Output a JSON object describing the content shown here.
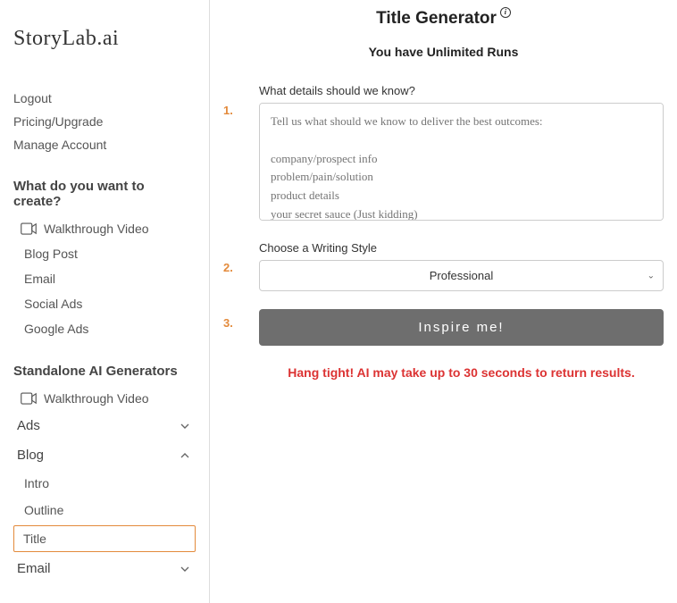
{
  "logo": "StoryLab.ai",
  "sidebar": {
    "top_links": [
      "Logout",
      "Pricing/Upgrade",
      "Manage Account"
    ],
    "create_heading": "What do you want to create?",
    "create_items": [
      "Walkthrough Video",
      "Blog Post",
      "Email",
      "Social Ads",
      "Google Ads"
    ],
    "standalone_heading": "Standalone AI Generators",
    "standalone_walkthrough": "Walkthrough Video",
    "groups": {
      "ads": {
        "label": "Ads",
        "expanded": false
      },
      "blog": {
        "label": "Blog",
        "expanded": true,
        "items": [
          "Intro",
          "Outline",
          "Title"
        ]
      },
      "email": {
        "label": "Email",
        "expanded": false
      }
    }
  },
  "main": {
    "title": "Title Generator",
    "runs_text": "You have Unlimited Runs",
    "step1": {
      "label": "What details should we know?",
      "placeholder": "Tell us what should we know to deliver the best outcomes:\n\ncompany/prospect info\nproblem/pain/solution\nproduct details\nyour secret sauce (Just kidding)"
    },
    "step2": {
      "label": "Choose a Writing Style",
      "selected": "Professional"
    },
    "step3": {
      "button": "Inspire me!"
    },
    "wait_text": "Hang tight! AI may take up to 30 seconds to return results."
  },
  "step_numbers": [
    "1.",
    "2.",
    "3."
  ]
}
